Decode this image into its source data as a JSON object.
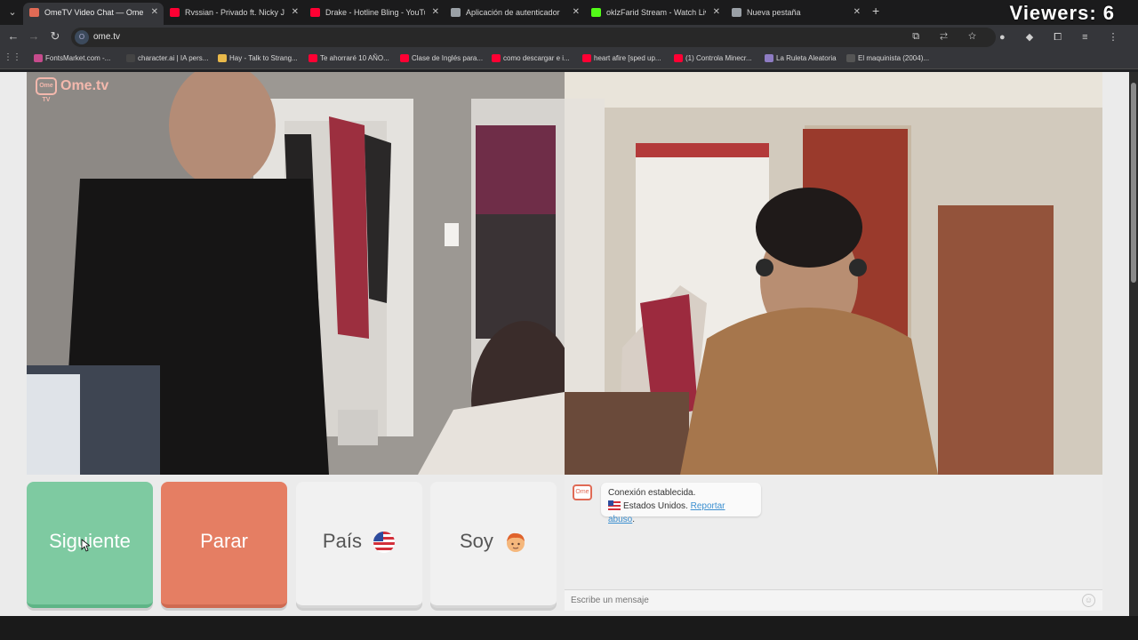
{
  "viewers": "Viewers: 6",
  "tabs": [
    {
      "title": "OmeTV Video Chat — Ome",
      "color": "#e06a55",
      "active": true
    },
    {
      "title": "Rvssian - Privado ft. Nicky Jam",
      "color": "#ff0033",
      "active": false
    },
    {
      "title": "Drake - Hotline Bling - YouTube",
      "color": "#ff0033",
      "active": false
    },
    {
      "title": "Aplicación de autenticador",
      "color": "#9aa0a6",
      "active": false
    },
    {
      "title": "oklzFarid Stream - Watch Live o",
      "color": "#53fc18",
      "active": false
    },
    {
      "title": "Nueva pestaña",
      "color": "#9aa0a6",
      "active": false
    }
  ],
  "address": {
    "url": "ome.tv"
  },
  "bookmarks": [
    {
      "label": "FontsMarket.com -...",
      "color": "#c64b8c"
    },
    {
      "label": "character.ai | IA pers...",
      "color": "#444444"
    },
    {
      "label": "Hay - Talk to Strang...",
      "color": "#e9b94a"
    },
    {
      "label": "Te ahorraré 10 AÑO...",
      "color": "#ff0033"
    },
    {
      "label": "Clase de Inglés para...",
      "color": "#ff0033"
    },
    {
      "label": "como descargar e i...",
      "color": "#ff0033"
    },
    {
      "label": "heart afire [sped up...",
      "color": "#ff0033"
    },
    {
      "label": "(1) Controla Minecr...",
      "color": "#ff0033"
    },
    {
      "label": "La Ruleta Aleatoria",
      "color": "#8e7cc3"
    },
    {
      "label": "El maquinista (2004)...",
      "color": "#555555"
    }
  ],
  "logo": {
    "text": "Ome.tv",
    "badge": "Ome TV"
  },
  "buttons": {
    "next": "Siguiente",
    "stop": "Parar",
    "country": "País",
    "me": "Soy"
  },
  "chat": {
    "status": "Conexión establecida.",
    "country": "Estados Unidos.",
    "report": "Reportar abuso",
    "placeholder": "Escribe un mensaje"
  }
}
